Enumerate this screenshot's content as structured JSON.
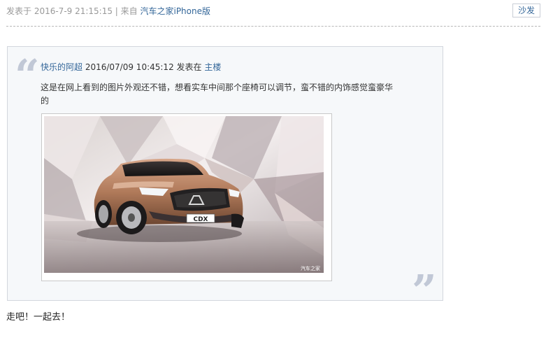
{
  "post": {
    "meta_prefix": "发表于 2016-7-9 21:15:15 | 来自 ",
    "source": "汽车之家iPhone版",
    "floor_label": "沙发"
  },
  "quote": {
    "author": "快乐的阿超",
    "time": " 2016/07/09 10:45:12 发表在 ",
    "floor": "主楼",
    "text": "这是在网上看到的图片外观还不错，想看实车中间那个座椅可以调节，蛮不错的内饰感觉蛮豪华的",
    "image": {
      "plate_text": "CDX",
      "watermark": "汽车之家"
    }
  },
  "reply": {
    "text": "走吧！一起去！"
  },
  "colors": {
    "link": "#336699",
    "meta_gray": "#999999",
    "quote_bg": "#f6f8fa",
    "quote_mark": "#c1c8d6",
    "car_body": "#b07a5a"
  }
}
